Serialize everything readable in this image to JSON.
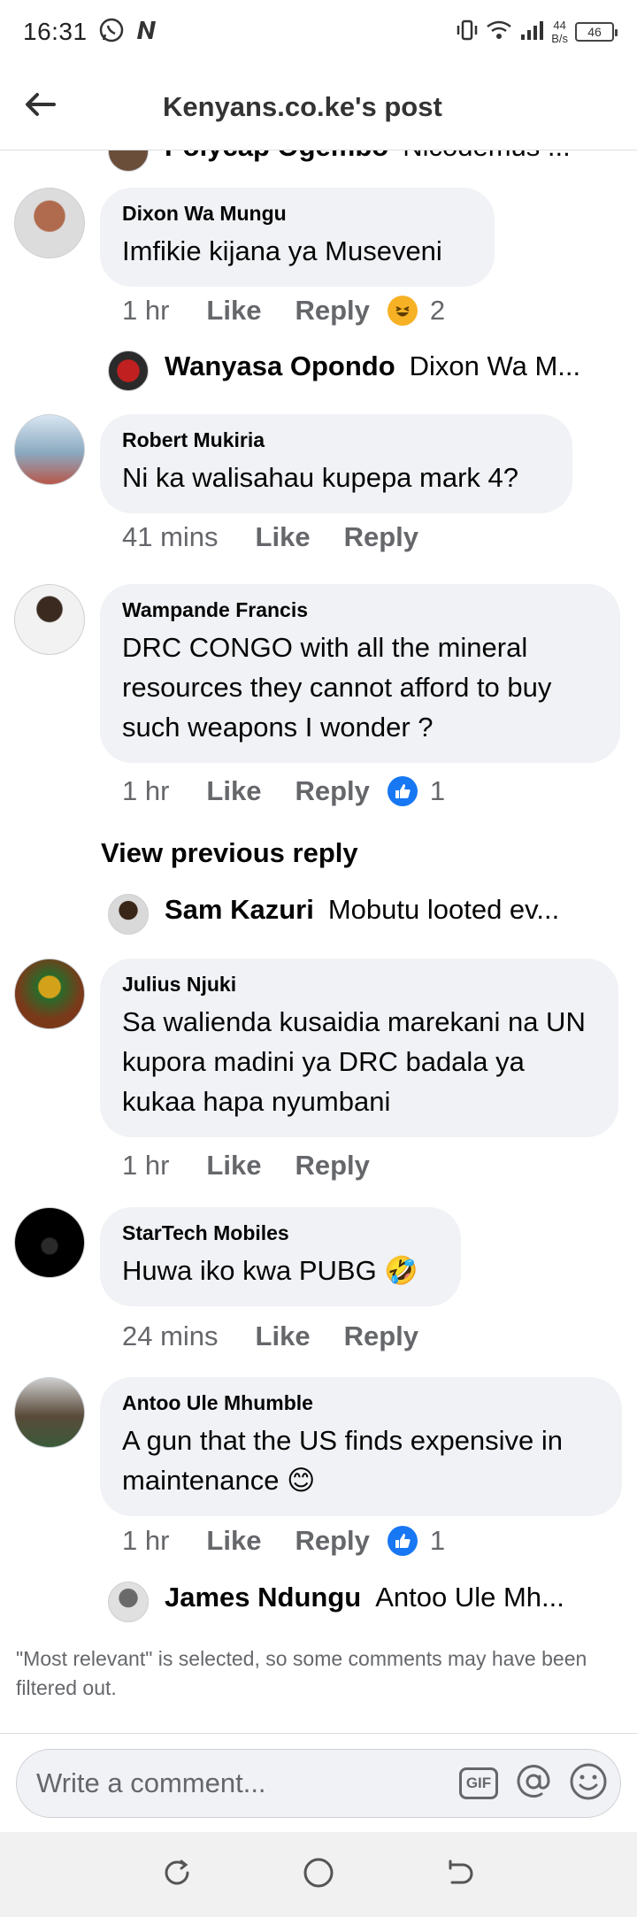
{
  "status": {
    "time": "16:31",
    "netspeed_value": "44",
    "netspeed_unit": "B/s",
    "battery": "46"
  },
  "header": {
    "title": "Kenyans.co.ke's post"
  },
  "comments": [
    {
      "author": "Dixon Wa Mungu",
      "text": "Imfikie kijana ya Museveni",
      "time": "1 hr",
      "like": "Like",
      "reply": "Reply",
      "reaction_count": "2",
      "reaction": "haha"
    },
    {
      "author": "Robert Mukiria",
      "text": "Ni ka walisahau kupepa mark 4?",
      "time": "41 mins",
      "like": "Like",
      "reply": "Reply"
    },
    {
      "author": "Wampande Francis",
      "text": "DRC CONGO with all the mineral resources they cannot afford to buy such weapons I wonder ?",
      "time": "1 hr",
      "like": "Like",
      "reply": "Reply",
      "reaction_count": "1",
      "reaction": "like"
    },
    {
      "author": "Julius Njuki",
      "text": "Sa walienda kusaidia marekani na UN kupora madini ya DRC badala ya kukaa hapa nyumbani",
      "time": "1 hr",
      "like": "Like",
      "reply": "Reply"
    },
    {
      "author": "StarTech Mobiles",
      "text": "Huwa iko kwa PUBG 🤣",
      "time": "24 mins",
      "like": "Like",
      "reply": "Reply"
    },
    {
      "author": "Antoo Ule Mhumble",
      "text": "A gun that the US finds expensive in maintenance 😊",
      "time": "1 hr",
      "like": "Like",
      "reply": "Reply",
      "reaction_count": "1",
      "reaction": "like"
    }
  ],
  "replies": [
    {
      "name": "Polycap Ogembo",
      "text": "Nicodemus ..."
    },
    {
      "name": "Wanyasa Opondo",
      "text": "Dixon Wa M..."
    },
    {
      "name": "Sam Kazuri",
      "text": "Mobutu looted ev..."
    },
    {
      "name": "James Ndungu",
      "text": "Antoo Ule Mh..."
    }
  ],
  "view_previous_reply": "View previous reply",
  "filter_note": "\"Most relevant\" is selected, so some comments may have been filtered out.",
  "composer": {
    "placeholder": "Write a comment...",
    "gif_label": "GIF"
  },
  "colors": {
    "secondary_text": "#65676b",
    "bubble_bg": "#f0f2f5",
    "like_blue": "#1877f2",
    "haha_yellow": "#f7b125"
  }
}
